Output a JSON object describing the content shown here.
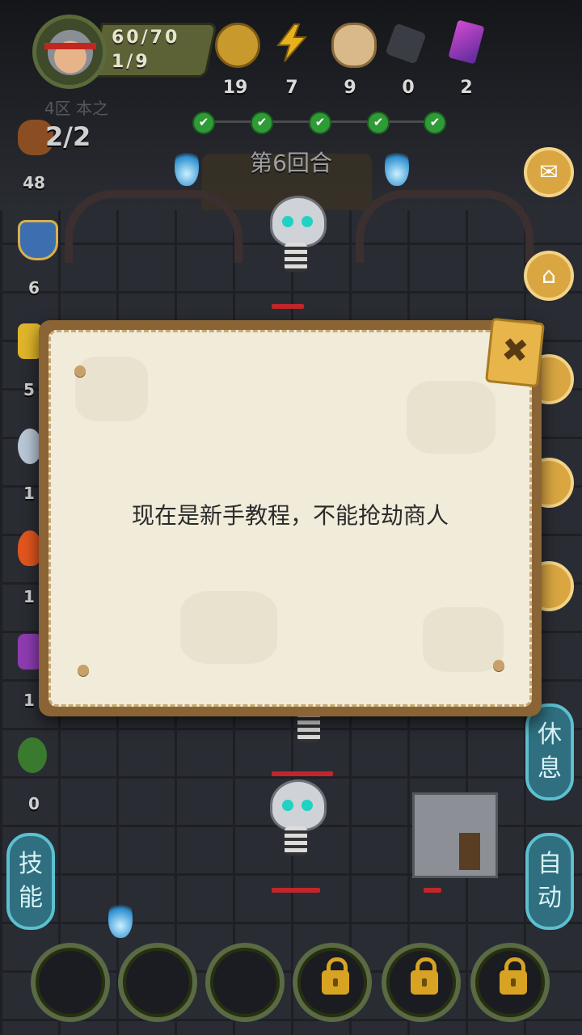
{
  "player": {
    "hp": "60/70",
    "level": "1/9",
    "faded_label": "4区 本之"
  },
  "resources": [
    {
      "icon": "coin-icon",
      "value": "19",
      "color": "#c89a2e"
    },
    {
      "icon": "energy-icon",
      "value": "7",
      "color": "#e8b21e"
    },
    {
      "icon": "bread-icon",
      "value": "9",
      "color": "#d9b98a"
    },
    {
      "icon": "ore-icon",
      "value": "0",
      "color": "#3a3d44"
    },
    {
      "icon": "crystal-icon",
      "value": "2",
      "color": "#9a3fb8"
    }
  ],
  "round": {
    "label": "第6回合",
    "checks": [
      "✔",
      "✔",
      "✔",
      "✔",
      "✔"
    ]
  },
  "left_stats": {
    "attack_count": "2/2",
    "items": [
      {
        "icon": "fist-icon",
        "value": "48"
      },
      {
        "icon": "shield-icon",
        "value": "6"
      },
      {
        "icon": "lightning-icon",
        "value": "5"
      },
      {
        "icon": "wind-icon",
        "value": "1"
      },
      {
        "icon": "fire-icon",
        "value": "1"
      },
      {
        "icon": "magic-icon",
        "value": "1"
      },
      {
        "icon": "poison-icon",
        "value": "0"
      }
    ]
  },
  "side_buttons": {
    "mail": "✉",
    "home": "⌂",
    "rest": "休息",
    "auto": "自动",
    "skill": "技能"
  },
  "dialog": {
    "message": "现在是新手教程，不能抢劫商人",
    "close": "✖"
  },
  "colors": {
    "accent_gold": "#d9a642",
    "button_teal": "#2f6f7f",
    "hp_red": "#c0262b"
  }
}
